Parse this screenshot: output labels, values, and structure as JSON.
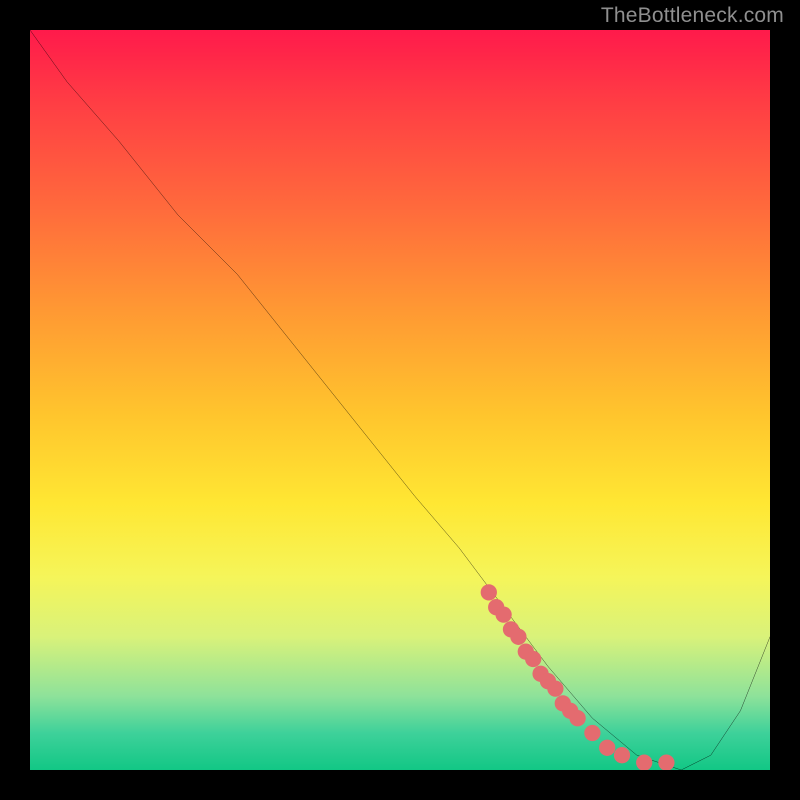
{
  "attribution": "TheBottleneck.com",
  "colors": {
    "page_bg": "#000000",
    "gradient_top": "#ff1a4b",
    "gradient_bottom": "#12c785",
    "curve": "#000000",
    "points": "#e46b6f"
  },
  "chart_data": {
    "type": "line",
    "title": "",
    "xlabel": "",
    "ylabel": "",
    "xlim": [
      0,
      100
    ],
    "ylim": [
      0,
      100
    ],
    "grid": false,
    "legend": false,
    "series": [
      {
        "name": "curve",
        "x": [
          0,
          5,
          12,
          20,
          28,
          36,
          44,
          52,
          58,
          64,
          70,
          76,
          82,
          88,
          92,
          96,
          100
        ],
        "y": [
          100,
          93,
          85,
          75,
          67,
          57,
          47,
          37,
          30,
          22,
          14,
          7,
          2,
          0,
          2,
          8,
          18
        ]
      }
    ],
    "points": [
      {
        "x": 62,
        "y": 24
      },
      {
        "x": 63,
        "y": 22
      },
      {
        "x": 64,
        "y": 21
      },
      {
        "x": 65,
        "y": 19
      },
      {
        "x": 66,
        "y": 18
      },
      {
        "x": 67,
        "y": 16
      },
      {
        "x": 68,
        "y": 15
      },
      {
        "x": 69,
        "y": 13
      },
      {
        "x": 70,
        "y": 12
      },
      {
        "x": 71,
        "y": 11
      },
      {
        "x": 72,
        "y": 9
      },
      {
        "x": 73,
        "y": 8
      },
      {
        "x": 74,
        "y": 7
      },
      {
        "x": 76,
        "y": 5
      },
      {
        "x": 78,
        "y": 3
      },
      {
        "x": 80,
        "y": 2
      },
      {
        "x": 83,
        "y": 1
      },
      {
        "x": 86,
        "y": 1
      }
    ]
  }
}
